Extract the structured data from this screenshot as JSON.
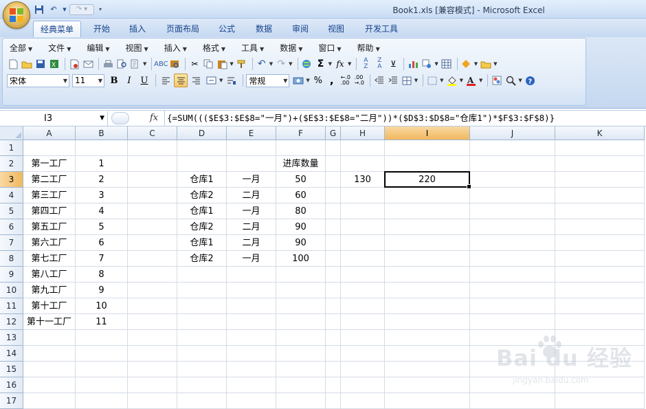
{
  "window": {
    "title": "Book1.xls  [兼容模式] - Microsoft Excel"
  },
  "ribbon_tabs": [
    {
      "label": "经典菜单",
      "active": true
    },
    {
      "label": "开始"
    },
    {
      "label": "插入"
    },
    {
      "label": "页面布局"
    },
    {
      "label": "公式"
    },
    {
      "label": "数据"
    },
    {
      "label": "审阅"
    },
    {
      "label": "视图"
    },
    {
      "label": "开发工具"
    }
  ],
  "classic_menu": [
    "全部",
    "文件",
    "编辑",
    "视图",
    "插入",
    "格式",
    "工具",
    "数据",
    "窗口",
    "帮助"
  ],
  "toolbar": {
    "font_name": "宋体",
    "font_size": "11",
    "number_format": "常规",
    "bold_label": "B",
    "italic_label": "I",
    "underline_label": "U",
    "autosum_label": "Σ",
    "function_label": "fx",
    "percent_label": "%",
    "comma_label": ","
  },
  "formula_bar": {
    "name_box": "I3",
    "fx_label": "fx",
    "formula": "{=SUM((($E$3:$E$8=\"一月\")+($E$3:$E$8=\"二月\"))*($D$3:$D$8=\"仓库1\")*$F$3:$F$8)}"
  },
  "columns": [
    "A",
    "B",
    "C",
    "D",
    "E",
    "F",
    "G",
    "H",
    "I",
    "J",
    "K"
  ],
  "selected_column": "I",
  "selected_row": "3",
  "rows": [
    "1",
    "2",
    "3",
    "4",
    "5",
    "6",
    "7",
    "8",
    "9",
    "10",
    "11",
    "12",
    "13",
    "14",
    "15",
    "16",
    "17"
  ],
  "cells": {
    "A2": "第一工厂",
    "B2": "1",
    "F2": "进库数量",
    "A3": "第二工厂",
    "B3": "2",
    "D3": "仓库1",
    "E3": "一月",
    "F3": "50",
    "H3": "130",
    "I3": "220",
    "A4": "第三工厂",
    "B4": "3",
    "D4": "仓库2",
    "E4": "二月",
    "F4": "60",
    "A5": "第四工厂",
    "B5": "4",
    "D5": "仓库1",
    "E5": "一月",
    "F5": "80",
    "A6": "第五工厂",
    "B6": "5",
    "D6": "仓库2",
    "E6": "二月",
    "F6": "90",
    "A7": "第六工厂",
    "B7": "6",
    "D7": "仓库1",
    "E7": "二月",
    "F7": "90",
    "A8": "第七工厂",
    "B8": "7",
    "D8": "仓库2",
    "E8": "一月",
    "F8": "100",
    "A9": "第八工厂",
    "B9": "8",
    "A10": "第九工厂",
    "B10": "9",
    "A11": "第十工厂",
    "B11": "10",
    "A12": "第十一工厂",
    "B12": "11"
  },
  "watermark": {
    "brand": "Bai  du 经验",
    "url": "jingyan.baidu.com"
  },
  "colors": {
    "selection_header": "#f1b75f",
    "ribbon_text": "#15428b",
    "grid_line": "#d4dbe6"
  }
}
